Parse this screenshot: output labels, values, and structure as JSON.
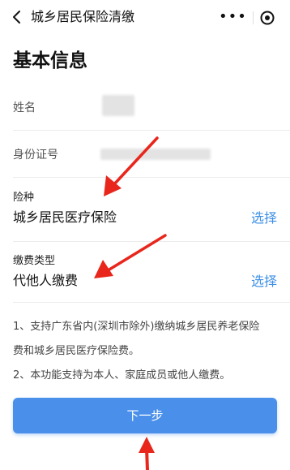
{
  "nav": {
    "title": "城乡居民保险清缴",
    "more_glyph": "•••"
  },
  "section": {
    "title": "基本信息"
  },
  "rows": {
    "name_label": "姓名",
    "id_label": "身份证号"
  },
  "insurance_type": {
    "label": "险种",
    "value": "城乡居民医疗保险",
    "select": "选择"
  },
  "payment_type": {
    "label": "缴费类型",
    "value": "代他人缴费",
    "select": "选择"
  },
  "notes": [
    "1、支持广东省内(深圳市除外)缴纳城乡居民养老保险",
    "费和城乡居民医疗保险费。",
    "2、本功能支持为本人、家庭成员或他人缴费。"
  ],
  "button": {
    "next": "下一步"
  },
  "colors": {
    "accent": "#3d8fe6",
    "button": "#4a90ea",
    "arrow": "#e8261c"
  },
  "icons": {
    "back": "chevron-left-icon",
    "more": "more-dots-icon",
    "close": "target-circle-icon"
  }
}
